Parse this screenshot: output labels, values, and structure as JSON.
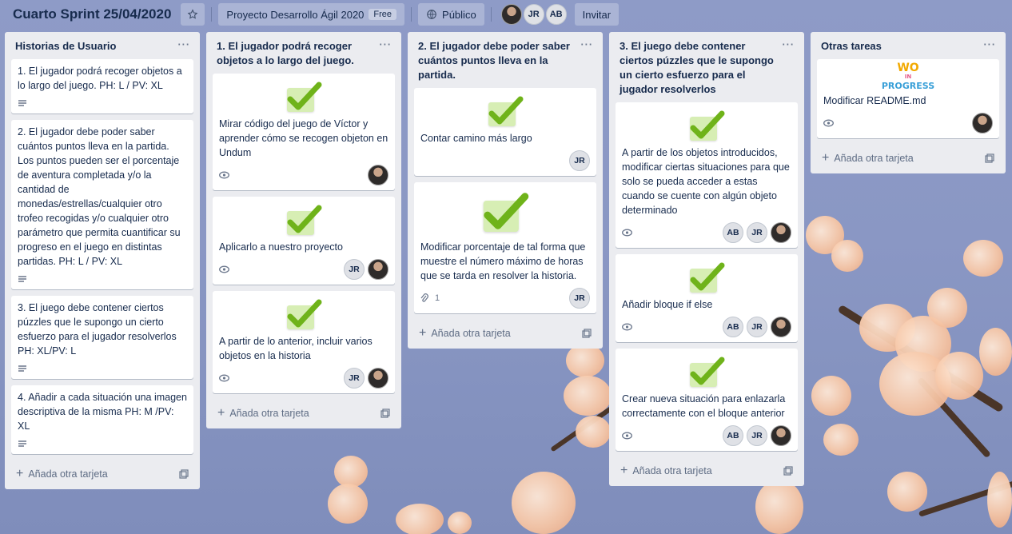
{
  "board": {
    "title": "Cuarto Sprint 25/04/2020",
    "team_name": "Proyecto Desarrollo Ágil 2020",
    "team_plan": "Free",
    "visibility": "Público",
    "invite_label": "Invitar",
    "members": [
      "JR",
      "AB"
    ]
  },
  "colors": {
    "background": "#8a97c4",
    "list_bg": "#ebecf0",
    "card_bg": "#ffffff",
    "check_green": "#6fb31a"
  },
  "lists": [
    {
      "title": "Historias de Usuario",
      "cards": [
        {
          "text": "1. El jugador podrá recoger objetos a lo largo del juego. PH: L / PV: XL"
        },
        {
          "text": "2. El jugador debe poder saber cuántos puntos lleva en la partida. Los puntos pueden ser el porcentaje de aventura completada y/o la cantidad de monedas/estrellas/cualquier otro trofeo recogidas y/o cualquier otro parámetro que permita cuantificar su progreso en el juego en distintas partidas. PH: L / PV: XL"
        },
        {
          "text": "3. El juego debe contener ciertos púzzles que le supongo un cierto esfuerzo para el jugador resolverlos PH: XL/PV: L"
        },
        {
          "text": "4. Añadir a cada situación una imagen descriptiva de la misma PH: M /PV: XL"
        }
      ],
      "add_label": "Añada otra tarjeta"
    },
    {
      "title": "1. El jugador podrá recoger objetos a lo largo del juego.",
      "cards": [
        {
          "text": "Mirar código del juego de Víctor y aprender cómo se recogen objeton en Undum"
        },
        {
          "text": "Aplicarlo a nuestro proyecto",
          "members": [
            "JR"
          ]
        },
        {
          "text": "A partir de lo anterior, incluir varios objetos en la historia",
          "members": [
            "JR"
          ]
        }
      ],
      "add_label": "Añada otra tarjeta"
    },
    {
      "title": "2. El jugador debe poder saber cuántos puntos lleva en la partida.",
      "cards": [
        {
          "text": "Contar camino más largo",
          "members": [
            "JR"
          ]
        },
        {
          "text": "Modificar porcentaje de tal forma que muestre el número máximo de horas que se tarda en resolver la historia.",
          "attachments": "1",
          "members": [
            "JR"
          ]
        }
      ],
      "add_label": "Añada otra tarjeta"
    },
    {
      "title": "3. El juego debe contener ciertos púzzles que le supongo un cierto esfuerzo para el jugador resolverlos",
      "cards": [
        {
          "text": "A partir de los objetos introducidos, modificar ciertas situaciones para que solo se pueda acceder a estas cuando se cuente con algún objeto determinado",
          "members": [
            "AB",
            "JR"
          ]
        },
        {
          "text": "Añadir bloque if else",
          "members": [
            "AB",
            "JR"
          ]
        },
        {
          "text": "Crear nueva situación para enlazarla correctamente con el bloque anterior",
          "members": [
            "AB",
            "JR"
          ]
        }
      ],
      "add_label": "Añada otra tarjeta"
    },
    {
      "title": "Otras tareas",
      "cards": [
        {
          "cover_text": [
            "WO",
            "IN",
            "PROGRESS"
          ],
          "text": "Modificar README.md"
        }
      ],
      "add_label": "Añada otra tarjeta"
    }
  ],
  "icons": {
    "star": "star-icon",
    "team": "team-icon",
    "globe": "globe-icon",
    "description": "description-icon",
    "eye": "eye-icon",
    "paperclip": "paperclip-icon",
    "plus": "plus-icon",
    "template": "template-icon",
    "menu": "list-menu-icon"
  }
}
